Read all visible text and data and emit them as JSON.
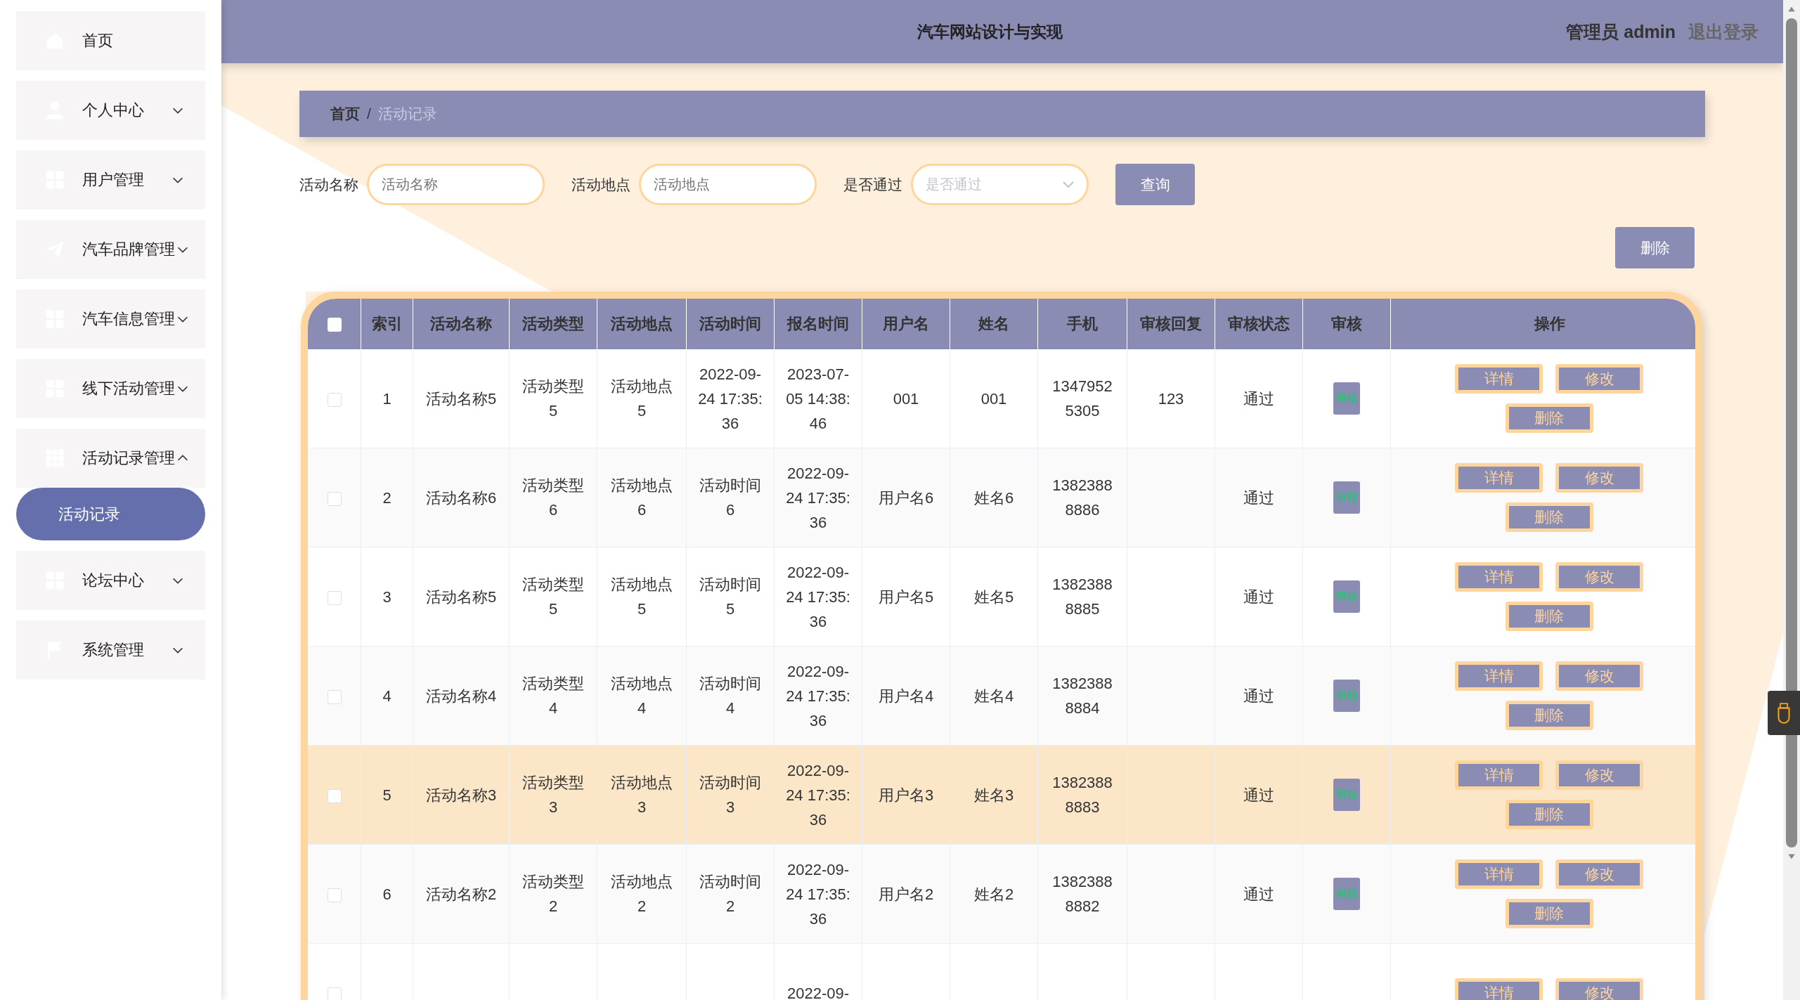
{
  "sidebar": {
    "items": [
      {
        "label": "首页",
        "kind": "link"
      },
      {
        "label": "个人中心",
        "expanded": false,
        "kind": "menu"
      },
      {
        "label": "用户管理",
        "expanded": false,
        "kind": "menu"
      },
      {
        "label": "汽车品牌管理",
        "expanded": false,
        "kind": "menu"
      },
      {
        "label": "汽车信息管理",
        "expanded": false,
        "kind": "menu"
      },
      {
        "label": "线下活动管理",
        "expanded": false,
        "kind": "menu"
      },
      {
        "label": "活动记录管理",
        "expanded": true,
        "kind": "menu",
        "children": [
          {
            "label": "活动记录",
            "selected": true
          }
        ]
      },
      {
        "label": "论坛中心",
        "expanded": false,
        "kind": "menu"
      },
      {
        "label": "系统管理",
        "expanded": false,
        "kind": "menu"
      }
    ]
  },
  "header": {
    "title": "汽车网站设计与实现",
    "user": "管理员 admin",
    "logout": "退出登录"
  },
  "breadcrumb": [
    "首页",
    "/",
    "活动记录"
  ],
  "search": {
    "fields": [
      {
        "label": "活动名称",
        "placeholder": "活动名称",
        "kind": "input"
      },
      {
        "label": "活动地点",
        "placeholder": "活动地点",
        "kind": "input"
      },
      {
        "label": "是否通过",
        "placeholder": "是否通过",
        "kind": "select"
      }
    ],
    "button": "查询"
  },
  "delete_button": "删除",
  "table": {
    "select_all_checked": false,
    "columns": [
      "索引",
      "活动名称",
      "活动类型",
      "活动地点",
      "活动时间",
      "报名时间",
      "用户名",
      "姓名",
      "手机",
      "审核回复",
      "审核状态",
      "审核",
      "操作"
    ],
    "rows": [
      {
        "checked": false,
        "highlighted": false,
        "cells": [
          "1",
          "活动名称5",
          "活动类型5",
          "活动地点5",
          "2022-09-24 17:35:36",
          "2023-07-05 14:38:46",
          "001",
          "001",
          "13479525305",
          "123",
          "通过"
        ],
        "review": "审核",
        "actions": [
          "详情",
          "修改",
          "删除"
        ]
      },
      {
        "checked": false,
        "highlighted": false,
        "cells": [
          "2",
          "活动名称6",
          "活动类型6",
          "活动地点6",
          "活动时间6",
          "2022-09-24 17:35:36",
          "用户名6",
          "姓名6",
          "13823888886",
          "",
          "通过"
        ],
        "review": "审核",
        "actions": [
          "详情",
          "修改",
          "删除"
        ]
      },
      {
        "checked": false,
        "highlighted": false,
        "cells": [
          "3",
          "活动名称5",
          "活动类型5",
          "活动地点5",
          "活动时间5",
          "2022-09-24 17:35:36",
          "用户名5",
          "姓名5",
          "13823888885",
          "",
          "通过"
        ],
        "review": "审核",
        "actions": [
          "详情",
          "修改",
          "删除"
        ]
      },
      {
        "checked": false,
        "highlighted": false,
        "cells": [
          "4",
          "活动名称4",
          "活动类型4",
          "活动地点4",
          "活动时间4",
          "2022-09-24 17:35:36",
          "用户名4",
          "姓名4",
          "13823888884",
          "",
          "通过"
        ],
        "review": "审核",
        "actions": [
          "详情",
          "修改",
          "删除"
        ]
      },
      {
        "checked": false,
        "highlighted": true,
        "cells": [
          "5",
          "活动名称3",
          "活动类型3",
          "活动地点3",
          "活动时间3",
          "2022-09-24 17:35:36",
          "用户名3",
          "姓名3",
          "13823888883",
          "",
          "通过"
        ],
        "review": "审核",
        "actions": [
          "详情",
          "修改",
          "删除"
        ]
      },
      {
        "checked": false,
        "highlighted": false,
        "cells": [
          "6",
          "活动名称2",
          "活动类型2",
          "活动地点2",
          "活动时间2",
          "2022-09-24 17:35:36",
          "用户名2",
          "姓名2",
          "13823888882",
          "",
          "通过"
        ],
        "review": "审核",
        "actions": [
          "详情",
          "修改",
          "删除"
        ]
      },
      {
        "checked": false,
        "highlighted": false,
        "cells": [
          "",
          "",
          "",
          "",
          "",
          "2022-09-",
          "",
          "",
          "",
          "",
          ""
        ],
        "actions": [
          "详情",
          "修改"
        ]
      }
    ]
  }
}
